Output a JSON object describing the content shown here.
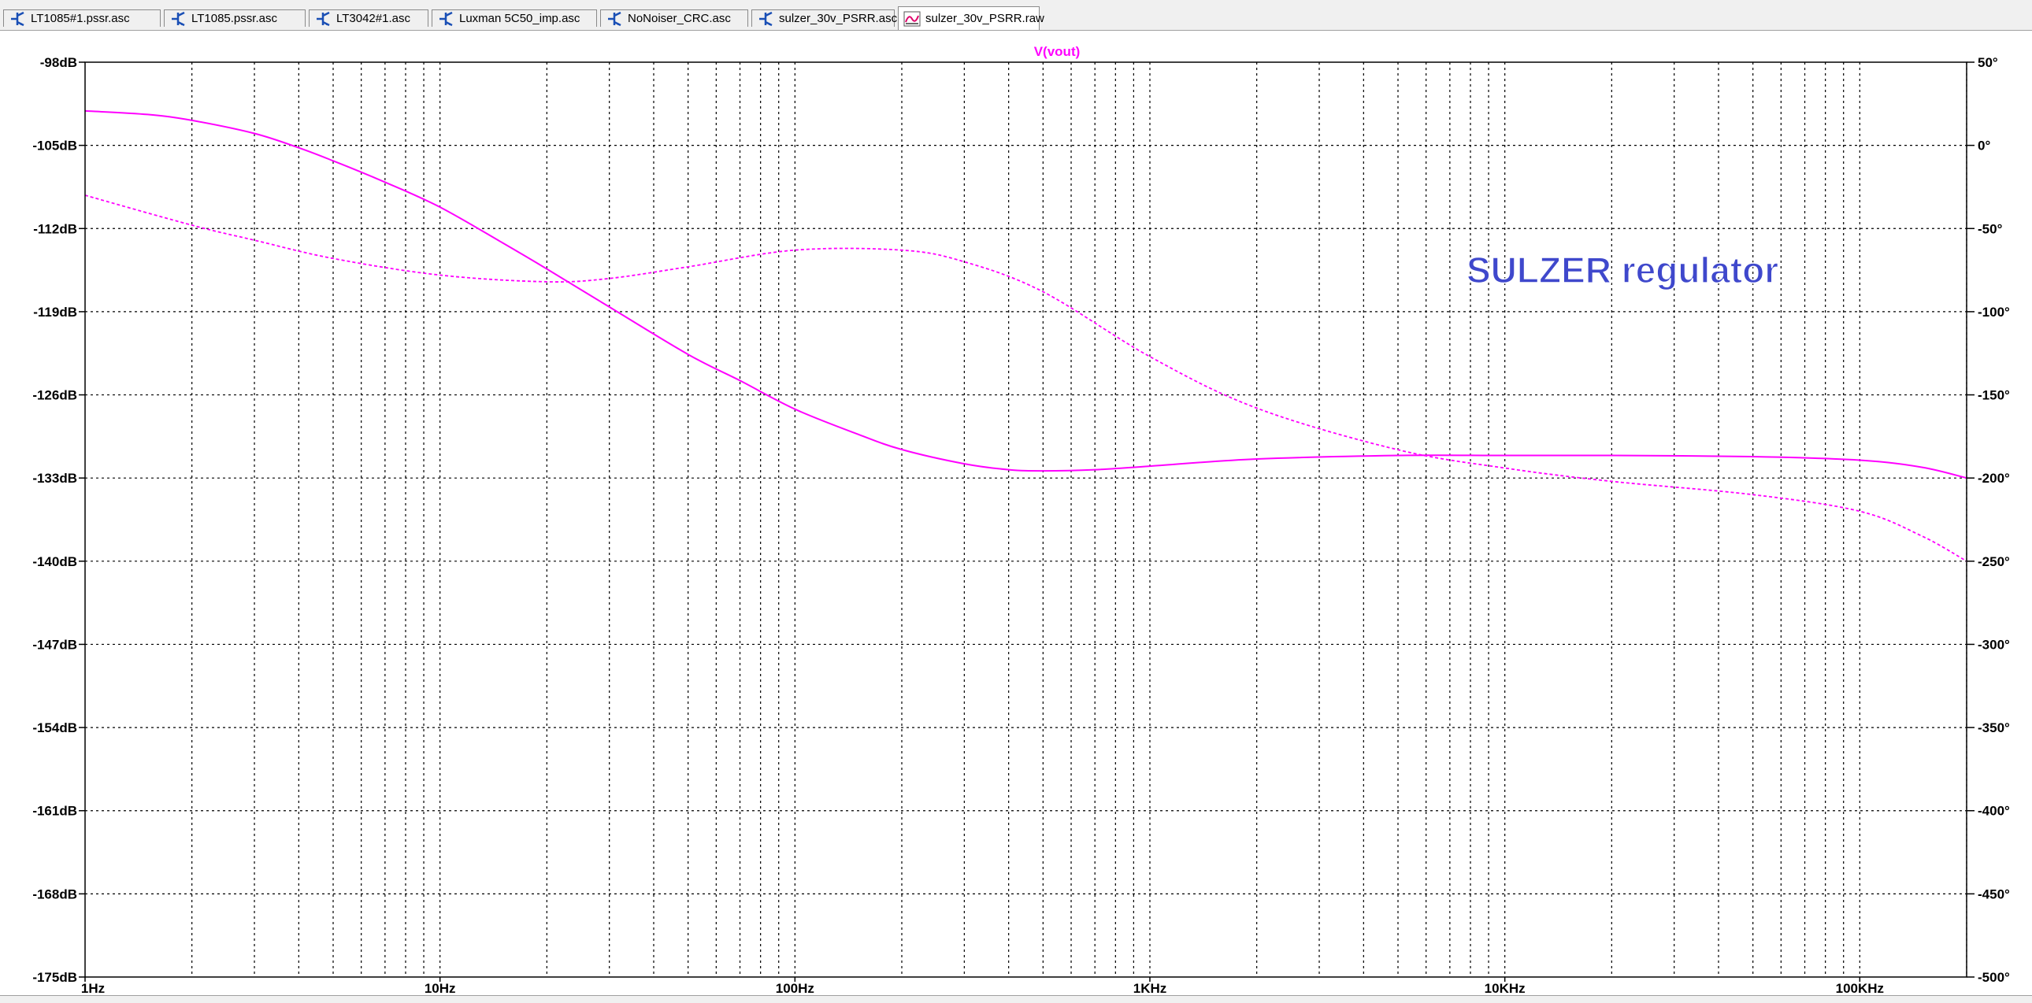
{
  "tabs": [
    {
      "label": "LT1085#1.pssr.asc",
      "icon": "schematic-icon",
      "active": false
    },
    {
      "label": "LT1085.pssr.asc",
      "icon": "schematic-icon",
      "active": false
    },
    {
      "label": "LT3042#1.asc",
      "icon": "schematic-icon",
      "active": false
    },
    {
      "label": "Luxman 5C50_imp.asc",
      "icon": "schematic-icon",
      "active": false
    },
    {
      "label": "NoNoiser_CRC.asc",
      "icon": "schematic-icon",
      "active": false
    },
    {
      "label": "sulzer_30v_PSRR.asc",
      "icon": "schematic-icon",
      "active": false
    },
    {
      "label": "sulzer_30v_PSRR.raw",
      "icon": "waveform-icon",
      "active": true
    }
  ],
  "plot": {
    "trace_label": "V(vout)",
    "annotation": "SULZER regulator",
    "colors": {
      "trace": "#ff00ff",
      "grid": "#000000",
      "annotation": "#3f48cc",
      "background": "#ffffff"
    }
  },
  "chart_data": {
    "type": "line",
    "x_scale": "log",
    "xlim": [
      1,
      200000
    ],
    "ylim_left": [
      -175,
      -98
    ],
    "ylim_right": [
      -500,
      50
    ],
    "x_tick_labels": [
      "1Hz",
      "10Hz",
      "100Hz",
      "1KHz",
      "10KHz",
      "100KHz"
    ],
    "x_tick_values": [
      1,
      10,
      100,
      1000,
      10000,
      100000
    ],
    "y_left_tick_labels": [
      "-98dB",
      "-105dB",
      "-112dB",
      "-119dB",
      "-126dB",
      "-133dB",
      "-140dB",
      "-147dB",
      "-154dB",
      "-161dB",
      "-168dB",
      "-175dB"
    ],
    "y_left_tick_values": [
      -98,
      -105,
      -112,
      -119,
      -126,
      -133,
      -140,
      -147,
      -154,
      -161,
      -168,
      -175
    ],
    "y_right_tick_labels": [
      "50°",
      "0°",
      "-50°",
      "-100°",
      "-150°",
      "-200°",
      "-250°",
      "-300°",
      "-350°",
      "-400°",
      "-450°",
      "-500°"
    ],
    "y_right_tick_values": [
      50,
      0,
      -50,
      -100,
      -150,
      -200,
      -250,
      -300,
      -350,
      -400,
      -450,
      -500
    ],
    "grid": true,
    "series": [
      {
        "name": "V(vout)",
        "axis": "left",
        "style": "solid",
        "x": [
          1,
          1.5,
          2,
          3,
          4,
          5,
          7,
          10,
          15,
          20,
          30,
          50,
          70,
          100,
          150,
          200,
          300,
          400,
          500,
          700,
          1000,
          2000,
          5000,
          10000,
          20000,
          50000,
          100000,
          150000,
          200000
        ],
        "y": [
          -102.1,
          -102.4,
          -102.9,
          -104.0,
          -105.2,
          -106.3,
          -108.1,
          -110.2,
          -113.2,
          -115.4,
          -118.6,
          -122.6,
          -124.8,
          -127.2,
          -129.3,
          -130.6,
          -131.8,
          -132.3,
          -132.4,
          -132.3,
          -132.0,
          -131.4,
          -131.1,
          -131.1,
          -131.1,
          -131.2,
          -131.5,
          -132.1,
          -133.0
        ]
      },
      {
        "name": "V(vout) phase",
        "axis": "right",
        "style": "dashed",
        "x": [
          1,
          2,
          3,
          5,
          10,
          20,
          30,
          50,
          100,
          200,
          300,
          500,
          1000,
          2000,
          5000,
          10000,
          20000,
          50000,
          100000,
          150000,
          200000
        ],
        "y": [
          -30,
          -48,
          -57,
          -68,
          -78,
          -82,
          -80,
          -73,
          -63,
          -63,
          -70,
          -88,
          -127,
          -158,
          -183,
          -194,
          -202,
          -210,
          -220,
          -235,
          -250
        ]
      }
    ]
  }
}
